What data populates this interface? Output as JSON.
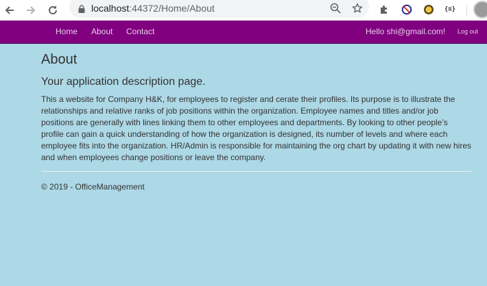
{
  "browser": {
    "url_host": "localhost",
    "url_path": ":44372/Home/About",
    "back_icon": "arrow-left-icon",
    "forward_icon": "arrow-right-icon",
    "reload_icon": "reload-icon",
    "lock_icon": "lock-icon",
    "zoom_icon": "zoom-out-icon",
    "bookmark_icon": "star-icon",
    "extension_json_label": "{≡}"
  },
  "navbar": {
    "color": "#800080",
    "links": [
      "Home",
      "About",
      "Contact"
    ],
    "greeting": "Hello shi@gmail.com!",
    "logout": "Log out"
  },
  "page": {
    "background": "#add8e6",
    "title": "About",
    "subtitle": "Your application description page.",
    "description": "This a website for Company H&K, for employees to register and cerate their profiles. Its purpose is to illustrate the relationships and relative ranks of job positions within the organization. Employee names and titles and/or job positions are generally with lines linking them to other employees and departments. By looking to other people’s profile can gain a quick understanding of how the organization is designed, its number of levels and where each employee fits into the organization. HR/Admin is responsible for maintaining the org chart by updating it with new hires and when employees change positions or leave the company.",
    "footer": "© 2019 - OfficeManagement"
  }
}
